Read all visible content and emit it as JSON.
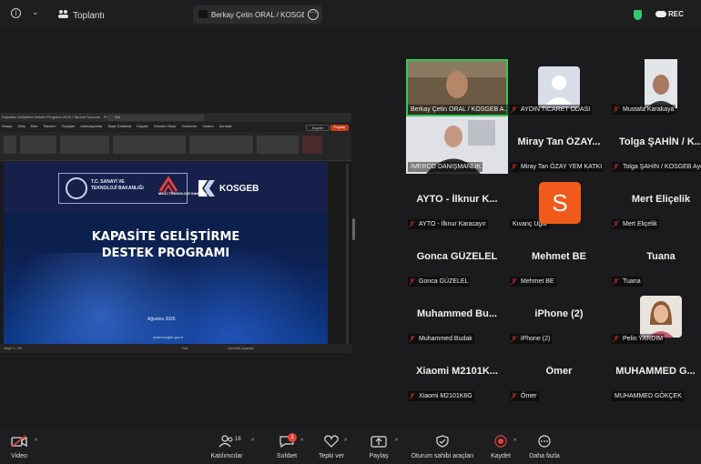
{
  "topbar": {
    "meeting_label": "Toplantı",
    "speaker_name": "Berkay Çetin ORAL / KOSGEB AYDIN",
    "rec_label": "REC"
  },
  "presentation": {
    "window_title": "Kapasite Geliştirme Destek Programı 2026 / Tanıtım Sunumu - PowerPoint",
    "search_placeholder": "Ara",
    "menu": [
      "Dosya",
      "Giriş",
      "Ekle",
      "Tasarım",
      "Geçişler",
      "Animasyonlar",
      "Slayt Gösterisi",
      "Kaydet",
      "Gözden Geçir",
      "Görünüm",
      "Yardım",
      "Acrobat"
    ],
    "kaydet": "Kaydet",
    "paylas": "Paylaş",
    "slide": {
      "ministry": "T.C. SANAYİ VE TEKNOLOJİ BAKANLIĞI",
      "milli": "MİLLİ TEKNOLOJİ HAMLESİ",
      "kosgeb": "KOSGEB",
      "title_line1": "KAPASİTE GELİŞTİRME",
      "title_line2": "DESTEK PROGRAMI",
      "date": "Ağustos 2026",
      "url": "www.kosgeb.gov.tr"
    },
    "status_left": "Slayt 1 / 50",
    "status_mid": "Not",
    "status_right": "Görüntü Ayarları"
  },
  "participants": [
    {
      "display": "",
      "label": "Berkay Çetin ORAL / KOSGEB A...",
      "muted": false,
      "video": "man-1",
      "active": true
    },
    {
      "display": "",
      "label": "AYDIN TİCARET ODASI",
      "muted": true,
      "video": "default-avatar"
    },
    {
      "display": "",
      "label": "Mustafa Karakaya",
      "muted": true,
      "video": "man-2"
    },
    {
      "display": "",
      "label": "İMERCO DANIŞMANLIK",
      "muted": false,
      "video": "man-3"
    },
    {
      "display": "Miray Tan ÖZAY...",
      "label": "Miray Tan ÖZAY YEM KATKI",
      "muted": true
    },
    {
      "display": "Tolga ŞAHİN / K...",
      "label": "Tolga ŞAHİN / KOSGEB Aydı",
      "muted": true
    },
    {
      "display": "AYTO - İlknur K...",
      "label": "AYTO - İlknur Karacayır",
      "muted": true
    },
    {
      "display": "S",
      "label": "Kıvanç Uğur",
      "muted": false
    },
    {
      "display": "Mert Eliçelik",
      "label": "Mert Eliçelik",
      "muted": true
    },
    {
      "display": "Gonca GÜZELEL",
      "label": "Gonca GÜZELEL",
      "muted": true
    },
    {
      "display": "Mehmet BE",
      "label": "Mehmet BE",
      "muted": true
    },
    {
      "display": "Tuana",
      "label": "Tuana",
      "muted": true
    },
    {
      "display": "Muhammed Bu...",
      "label": "Muhammed Budak",
      "muted": true
    },
    {
      "display": "iPhone (2)",
      "label": "iPhone (2)",
      "muted": true
    },
    {
      "display": "",
      "label": "Pelin YARDIM",
      "muted": true,
      "video": "woman-1"
    },
    {
      "display": "Xiaomi M2101K...",
      "label": "Xiaomi M2101K6G",
      "muted": true
    },
    {
      "display": "Ömer",
      "label": "Ömer",
      "muted": true
    },
    {
      "display": "MUHAMMED G...",
      "label": "MUHAMMED GÖKÇEK",
      "muted": false
    }
  ],
  "toolbar": {
    "video": "Video",
    "participants": "Katılımcılar",
    "participants_count": "18",
    "chat": "Sohbet",
    "chat_badge": "1",
    "react": "Tepki ver",
    "share": "Paylaş",
    "host_tools": "Oturum sahibi araçları",
    "record": "Kaydet",
    "more": "Daha fazla"
  },
  "colors": {
    "active_speaker": "#2fca5a",
    "avatar_s": "#f05a1a",
    "mute_red": "#e8413b"
  }
}
